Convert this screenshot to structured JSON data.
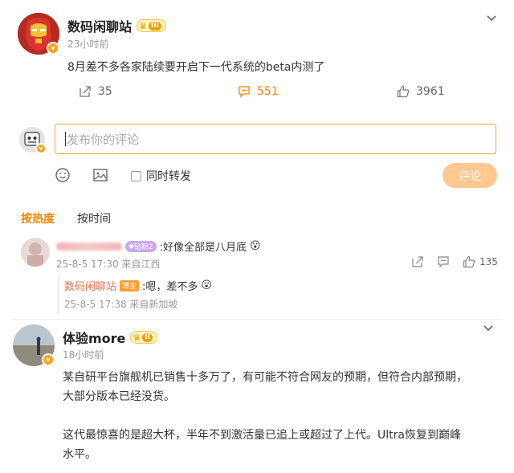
{
  "post": {
    "author": "数码闲聊站",
    "rank": "III",
    "time": "23小时前",
    "content": "8月差不多各家陆续要开启下一代系统的beta内测了",
    "shares": "35",
    "comments": "551",
    "likes": "3961"
  },
  "compose": {
    "placeholder": "发布你的评论",
    "forward_label": "同时转发",
    "submit_label": "评论"
  },
  "sort": {
    "hot": "按热度",
    "time": "按时间"
  },
  "comments": [
    {
      "vip": "钻粉2",
      "text": ":好像全部是八月底",
      "emoji": "😮",
      "meta": "25-8-5 17:30 来自江西",
      "likes": "135",
      "reply": {
        "author": "数码闲聊站",
        "tag": "博主",
        "text": ":嗯，差不多",
        "emoji": "😮",
        "meta": "25-8-5 17:38 来自新加坡"
      }
    }
  ],
  "second_post": {
    "author": "体验more",
    "rank": "II",
    "time": "18小时前",
    "paragraph1_line1": "某自研平台旗舰机已销售十多万了，有可能不符合网友的预期，但符合内部预期，",
    "paragraph1_line2": "大部分版本已经没货。",
    "paragraph2_line1": "这代最惊喜的是超大杯，半年不到激活量已追上或超过了上代。Ultra恢复到巅峰",
    "paragraph2_line2": "水平。"
  },
  "colors": {
    "accent": "#ff8200",
    "input_border": "#ffa230",
    "submit_bg": "#ffc891",
    "reply_name": "#eb7350"
  }
}
